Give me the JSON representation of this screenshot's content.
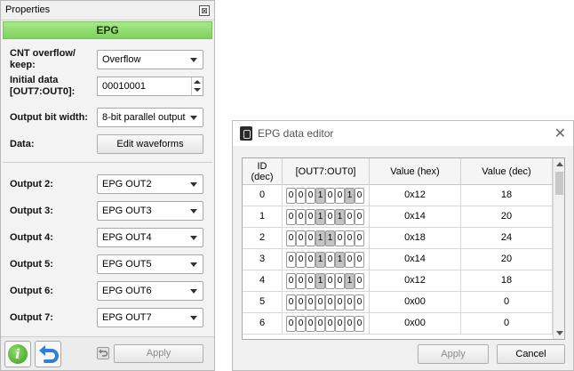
{
  "properties": {
    "title": "Properties",
    "close_glyph": "⊠",
    "section": "EPG",
    "cnt_label": "CNT overflow/ keep:",
    "cnt_value": "Overflow",
    "init_label": "Initial data [OUT7:OUT0]:",
    "init_value": "00010001",
    "width_label": "Output bit width:",
    "width_value": "8-bit parallel output",
    "data_label": "Data:",
    "edit_button": "Edit waveforms",
    "outputs": [
      {
        "label": "Output 2:",
        "value": "EPG OUT2"
      },
      {
        "label": "Output 3:",
        "value": "EPG OUT3"
      },
      {
        "label": "Output 4:",
        "value": "EPG OUT4"
      },
      {
        "label": "Output 5:",
        "value": "EPG OUT5"
      },
      {
        "label": "Output 6:",
        "value": "EPG OUT6"
      },
      {
        "label": "Output 7:",
        "value": "EPG OUT7"
      }
    ],
    "apply_button": "Apply",
    "info_glyph": "i"
  },
  "editor": {
    "title": "EPG data editor",
    "close_glyph": "✕",
    "columns": [
      "ID (dec)",
      "[OUT7:OUT0]",
      "Value (hex)",
      "Value (dec)"
    ],
    "rows": [
      {
        "id": "0",
        "bits": [
          "0",
          "0",
          "0",
          "1",
          "0",
          "0",
          "1",
          "0"
        ],
        "hex": "0x12",
        "dec": "18"
      },
      {
        "id": "1",
        "bits": [
          "0",
          "0",
          "0",
          "1",
          "0",
          "1",
          "0",
          "0"
        ],
        "hex": "0x14",
        "dec": "20"
      },
      {
        "id": "2",
        "bits": [
          "0",
          "0",
          "0",
          "1",
          "1",
          "0",
          "0",
          "0"
        ],
        "hex": "0x18",
        "dec": "24"
      },
      {
        "id": "3",
        "bits": [
          "0",
          "0",
          "0",
          "1",
          "0",
          "1",
          "0",
          "0"
        ],
        "hex": "0x14",
        "dec": "20"
      },
      {
        "id": "4",
        "bits": [
          "0",
          "0",
          "0",
          "1",
          "0",
          "0",
          "1",
          "0"
        ],
        "hex": "0x12",
        "dec": "18"
      },
      {
        "id": "5",
        "bits": [
          "0",
          "0",
          "0",
          "0",
          "0",
          "0",
          "0",
          "0"
        ],
        "hex": "0x00",
        "dec": "0"
      },
      {
        "id": "6",
        "bits": [
          "0",
          "0",
          "0",
          "0",
          "0",
          "0",
          "0",
          "0"
        ],
        "hex": "0x00",
        "dec": "0"
      }
    ],
    "apply_button": "Apply",
    "cancel_button": "Cancel"
  },
  "colors": {
    "section_header": "#7ed35c",
    "bit_on": "#c4c4c4"
  }
}
